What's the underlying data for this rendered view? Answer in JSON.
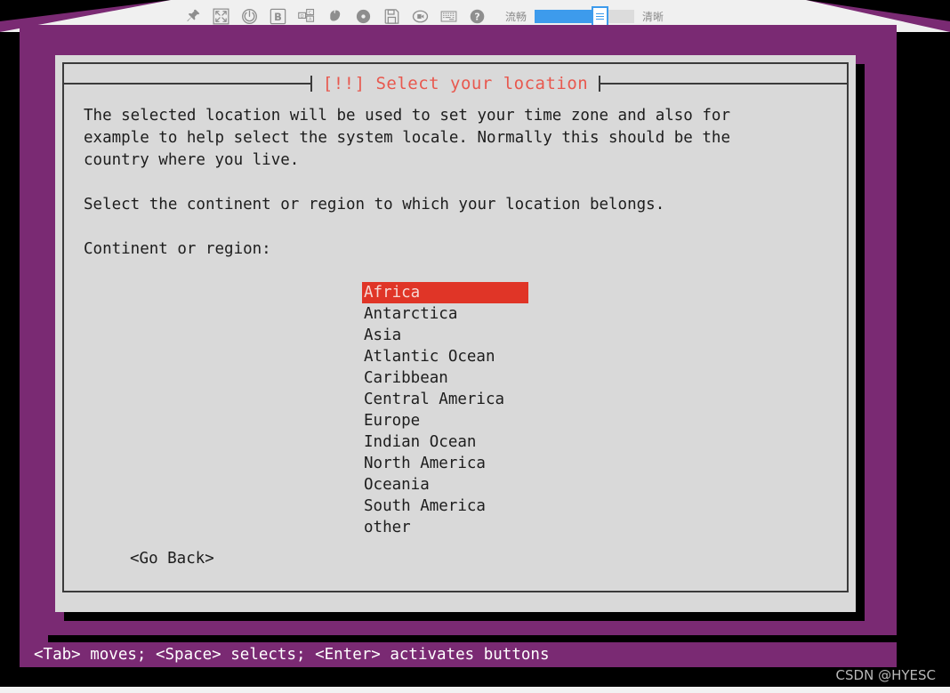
{
  "toolbar": {
    "icons": [
      {
        "name": "pin-icon",
        "label": "Pin"
      },
      {
        "name": "fullscreen-icon",
        "label": "Fullscreen"
      },
      {
        "name": "power-icon",
        "label": "Power"
      },
      {
        "name": "boxed-b-icon",
        "label": "B"
      },
      {
        "name": "ctrl-alt-del-icon",
        "label": "Ctrl+Alt+Del"
      },
      {
        "name": "mouse-icon",
        "label": "Mouse"
      },
      {
        "name": "disc-icon",
        "label": "Disc"
      },
      {
        "name": "save-floppy-icon",
        "label": "Save"
      },
      {
        "name": "video-camera-icon",
        "label": "Record"
      },
      {
        "name": "keyboard-icon",
        "label": "Keyboard"
      },
      {
        "name": "help-icon",
        "label": "Help"
      }
    ],
    "quality": {
      "left_label": "流畅",
      "right_label": "清晰",
      "fill_percent": 64
    }
  },
  "dialog": {
    "title": "[!!] Select your location",
    "paragraph": "The selected location will be used to set your time zone and also for\nexample to help select the system locale. Normally this should be the\ncountry where you live.",
    "prompt": "Select the continent or region to which your location belongs.",
    "field_label": "Continent or region:",
    "regions": [
      "Africa",
      "Antarctica",
      "Asia",
      "Atlantic Ocean",
      "Caribbean",
      "Central America",
      "Europe",
      "Indian Ocean",
      "North America",
      "Oceania",
      "South America",
      "other"
    ],
    "selected_region": "Africa",
    "go_back_label": "<Go Back>"
  },
  "statusbar": {
    "hint": "<Tab> moves; <Space> selects; <Enter> activates buttons"
  },
  "watermark": {
    "text": "CSDN @HYESC"
  },
  "colors": {
    "console_purple": "#7a2a73",
    "dialog_gray": "#d9d9d9",
    "title_red": "#e8584e",
    "highlight_red": "#e03527",
    "slider_blue": "#3d9bec"
  }
}
